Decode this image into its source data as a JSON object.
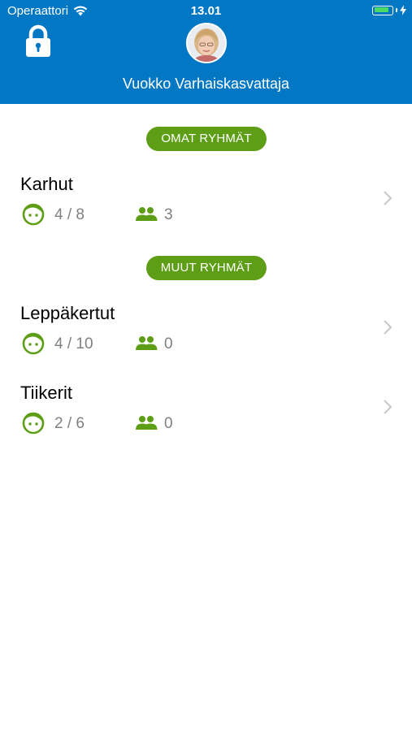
{
  "status_bar": {
    "carrier": "Operaattori",
    "time": "13.01",
    "battery_level": 0.85
  },
  "header": {
    "user_name": "Vuokko Varhaiskasvattaja",
    "icons": [
      "lock-icon",
      "avatar"
    ]
  },
  "sections": [
    {
      "label": "OMAT RYHMÄT",
      "groups": [
        {
          "name": "Karhut",
          "children": "4 / 8",
          "staff": "3"
        }
      ]
    },
    {
      "label": "MUUT RYHMÄT",
      "groups": [
        {
          "name": "Leppäkertut",
          "children": "4 / 10",
          "staff": "0"
        },
        {
          "name": "Tiikerit",
          "children": "2 / 6",
          "staff": "0"
        }
      ]
    }
  ],
  "colors": {
    "header_blue": "#0277c4",
    "accent_green": "#5e9e16",
    "count_gray": "#808080"
  }
}
